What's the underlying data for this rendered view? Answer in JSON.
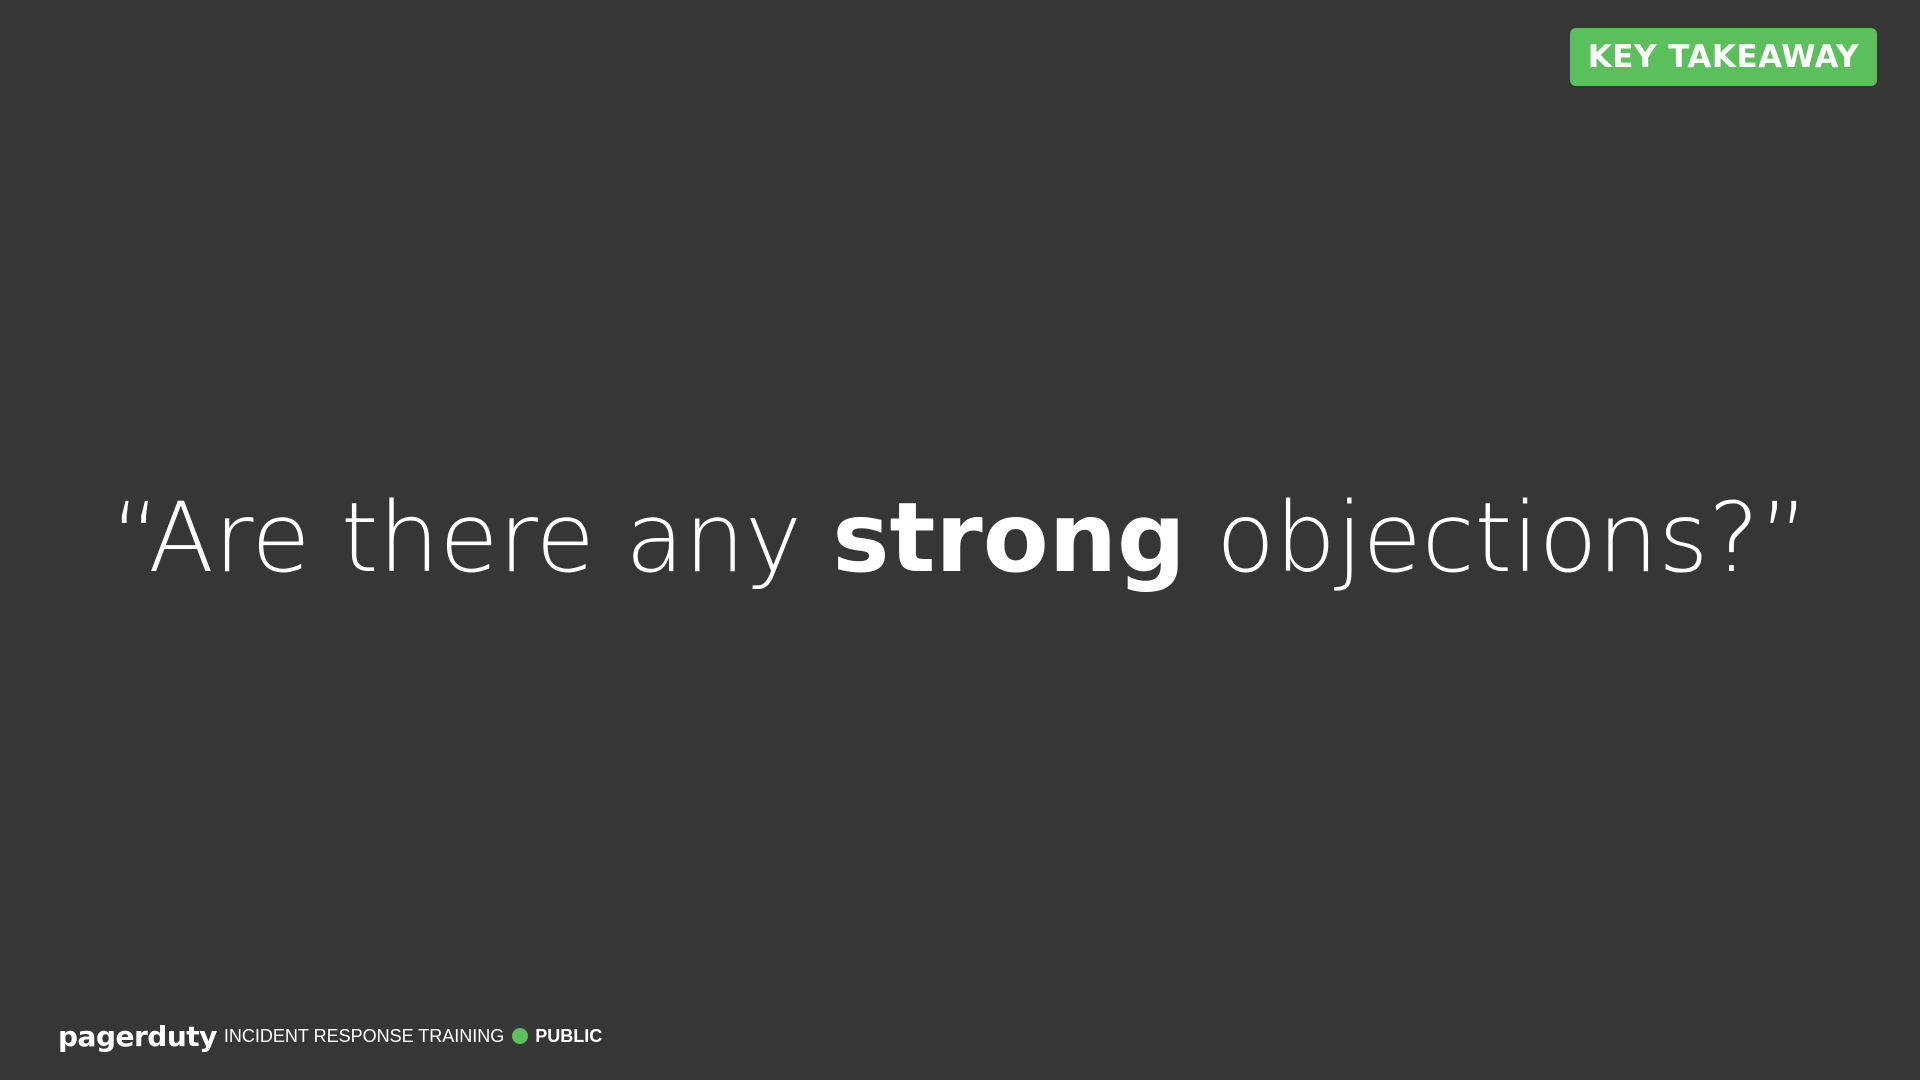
{
  "badge": {
    "label": "KEY TAKEAWAY",
    "color": "#5bbf5b"
  },
  "quote": {
    "open_mark": "“",
    "before": "Are there any ",
    "emphasis": "strong",
    "after": " objections?",
    "close_mark": "”"
  },
  "footer": {
    "logo": "pagerduty",
    "program": "INCIDENT RESPONSE TRAINING",
    "visibility": "PUBLIC",
    "dot_color": "#5bbf5b"
  },
  "colors": {
    "background": "#363636",
    "text": "#ffffff",
    "accent": "#5bbf5b"
  }
}
